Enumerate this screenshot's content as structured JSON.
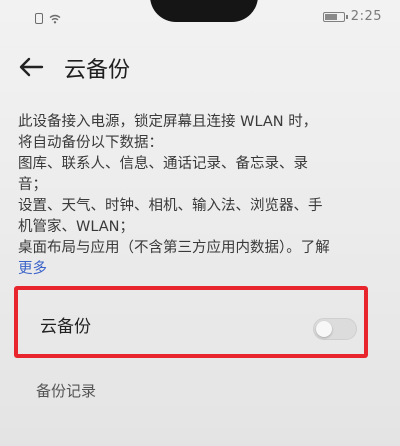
{
  "status_bar": {
    "time": "2:25"
  },
  "header": {
    "title": "云备份"
  },
  "description": {
    "lines": [
      "此设备接入电源，锁定屏幕且连接 WLAN 时，",
      "将自动备份以下数据：",
      "图库、联系人、信息、通话记录、备忘录、录",
      "音；",
      "设置、天气、时钟、相机、输入法、浏览器、手",
      "机管家、WLAN；",
      "桌面布局与应用（不含第三方应用内数据）。了解",
      "更多"
    ]
  },
  "cloud_backup_toggle": {
    "label": "云备份",
    "enabled": false
  },
  "backup_records": {
    "label": "备份记录"
  },
  "colors": {
    "highlight": "#e8242c",
    "link": "#3a62c9"
  }
}
